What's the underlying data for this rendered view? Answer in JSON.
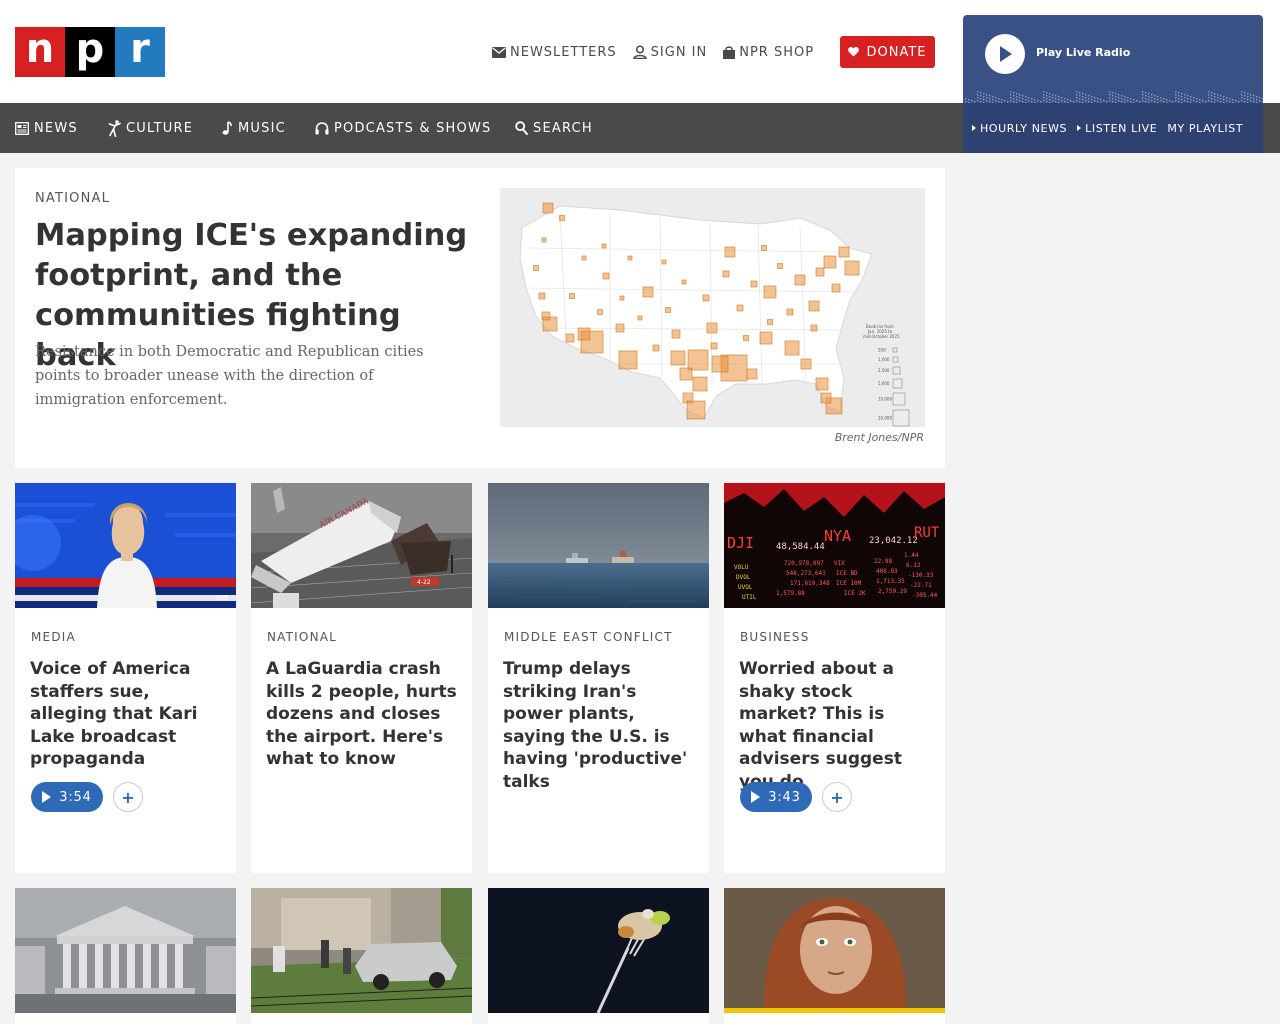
{
  "logo": {
    "n": "n",
    "p": "p",
    "r": "r"
  },
  "utility_nav": {
    "newsletters": "NEWSLETTERS",
    "sign_in": "SIGN IN",
    "shop": "NPR SHOP"
  },
  "donate_label": "DONATE",
  "main_nav": {
    "news": "NEWS",
    "culture": "CULTURE",
    "music": "MUSIC",
    "podcasts": "PODCASTS & SHOWS",
    "search": "SEARCH"
  },
  "player": {
    "label": "Play Live Radio",
    "hourly_news": "HOURLY NEWS",
    "listen_live": "LISTEN LIVE",
    "my_playlist": "MY PLAYLIST"
  },
  "featured": {
    "kicker": "NATIONAL",
    "title": "Mapping ICE's expanding footprint, and the communities fighting back",
    "teaser": "Resistance in both Democratic and Republican cities points to broader unease with the direction of immigration enforcement.",
    "credit": "Brent Jones/NPR",
    "map_legend": [
      "500",
      "1,000",
      "2,500",
      "5,000",
      "10,000",
      "20,000"
    ]
  },
  "cards": [
    {
      "kicker": "MEDIA",
      "title": "Voice of America staffers sue, alleging that Kari Lake broadcast propaganda",
      "duration": "3:54"
    },
    {
      "kicker": "NATIONAL",
      "title": "A LaGuardia crash kills 2 people, hurts dozens and closes the airport. Here's what to know"
    },
    {
      "kicker": "MIDDLE EAST CONFLICT",
      "title": "Trump delays striking Iran's power plants, saying the U.S. is having 'productive' talks"
    },
    {
      "kicker": "BUSINESS",
      "title": "Worried about a shaky stock market? This is what financial advisers suggest you do",
      "duration": "3:43"
    }
  ],
  "card_add_symbol": "+",
  "colors": {
    "npr_red": "#d62021",
    "npr_black": "#000000",
    "npr_blue": "#237bbd",
    "nav_gray": "#4a4a4a",
    "player_blue": "#3a5185",
    "audio_blue": "#2f6ab8",
    "map_marker": "#e8913a"
  }
}
